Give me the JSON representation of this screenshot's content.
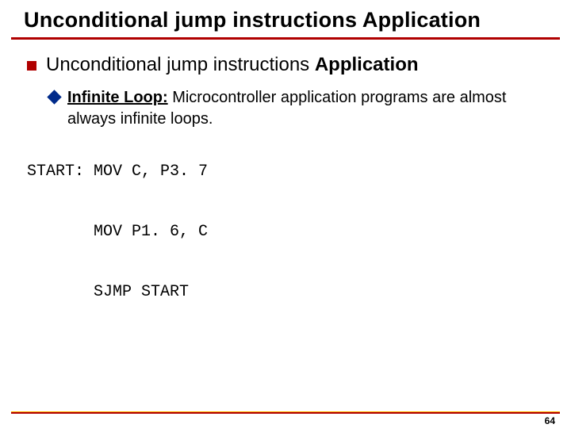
{
  "title": "Unconditional jump instructions Application",
  "heading_plain": "Unconditional jump instructions ",
  "heading_bold": "Application",
  "sub_lead": "Infinite Loop:",
  "sub_rest": " Microcontroller application programs are almost always infinite loops.",
  "code": "START: MOV C, P3. 7\n\n       MOV P1. 6, C\n\n       SJMP START",
  "page_number": "64"
}
